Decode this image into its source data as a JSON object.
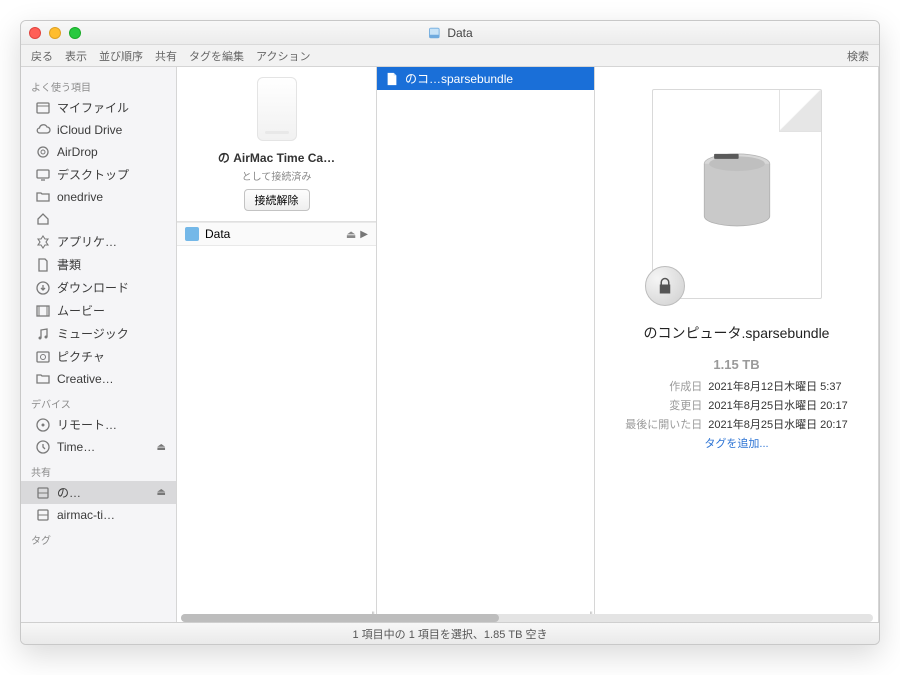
{
  "window": {
    "title": "Data"
  },
  "toolbar": {
    "items": [
      "戻る",
      "表示",
      "並び順序",
      "共有",
      "タグを編集",
      "アクション"
    ],
    "search": "検索"
  },
  "sidebar": {
    "sections": [
      {
        "header": "よく使う項目",
        "items": [
          {
            "icon": "myfiles",
            "label": "マイファイル"
          },
          {
            "icon": "icloud",
            "label": "iCloud Drive"
          },
          {
            "icon": "airdrop",
            "label": "AirDrop"
          },
          {
            "icon": "desktop",
            "label": "デスクトップ"
          },
          {
            "icon": "folder",
            "label": "onedrive"
          },
          {
            "icon": "home",
            "label": ""
          },
          {
            "icon": "apps",
            "label": "アプリケ…"
          },
          {
            "icon": "docs",
            "label": "書類"
          },
          {
            "icon": "downloads",
            "label": "ダウンロード"
          },
          {
            "icon": "movies",
            "label": "ムービー"
          },
          {
            "icon": "music",
            "label": "ミュージック"
          },
          {
            "icon": "pictures",
            "label": "ピクチャ"
          },
          {
            "icon": "folder",
            "label": "Creative…"
          }
        ]
      },
      {
        "header": "デバイス",
        "items": [
          {
            "icon": "disc",
            "label": "リモート…"
          },
          {
            "icon": "timemachine",
            "label": "Time…",
            "eject": true
          }
        ]
      },
      {
        "header": "共有",
        "items": [
          {
            "icon": "server",
            "label": "の…",
            "eject": true,
            "selected": true
          },
          {
            "icon": "server",
            "label": "airmac-ti…"
          }
        ]
      },
      {
        "header": "タグ",
        "items": []
      }
    ]
  },
  "col1": {
    "server_name": "の AirMac Time Ca…",
    "server_status": "として接続済み",
    "disconnect": "接続解除",
    "volume": "Data"
  },
  "col2": {
    "file": "のコ…sparsebundle"
  },
  "preview": {
    "name": "のコンピュータ.sparsebundle",
    "size": "1.15 TB",
    "meta": [
      {
        "k": "作成日",
        "v": "2021年8月12日木曜日 5:37"
      },
      {
        "k": "変更日",
        "v": "2021年8月25日水曜日 20:17"
      },
      {
        "k": "最後に開いた日",
        "v": "2021年8月25日水曜日 20:17"
      }
    ],
    "add_tags": "タグを追加..."
  },
  "status": "1 項目中の 1 項目を選択、1.85 TB 空き"
}
